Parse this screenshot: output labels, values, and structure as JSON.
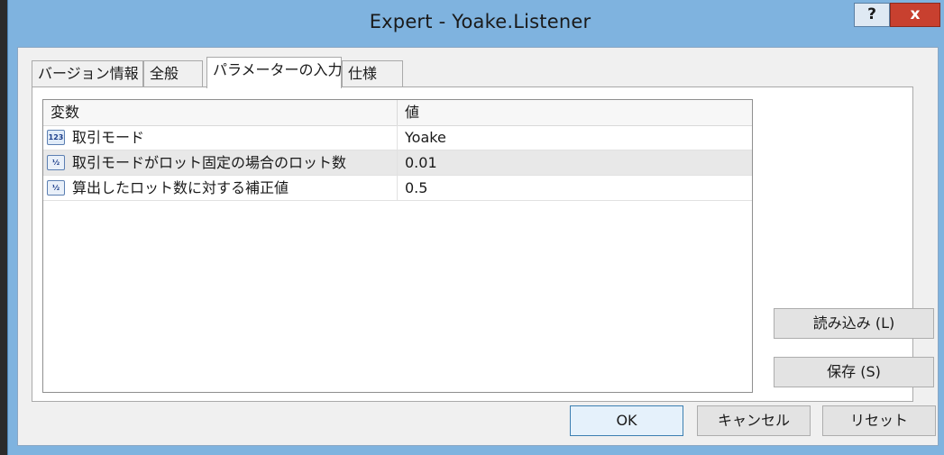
{
  "window": {
    "title": "Expert - Yoake.Listener",
    "help_label": "?",
    "close_label": "x"
  },
  "tabs": [
    {
      "label": "バージョン情報",
      "active": false
    },
    {
      "label": "全般",
      "active": false
    },
    {
      "label": "パラメーターの入力",
      "active": true
    },
    {
      "label": "仕様",
      "active": false
    }
  ],
  "grid": {
    "headers": [
      "変数",
      "値"
    ],
    "rows": [
      {
        "icon": "integer-param-icon",
        "icon_text": "123",
        "name": "取引モード",
        "value": "Yoake",
        "selected": false
      },
      {
        "icon": "double-param-icon",
        "icon_text": "½",
        "name": "取引モードがロット固定の場合のロット数",
        "value": "0.01",
        "selected": true
      },
      {
        "icon": "double-param-icon",
        "icon_text": "½",
        "name": "算出したロット数に対する補正値",
        "value": "0.5",
        "selected": false
      }
    ]
  },
  "side_buttons": {
    "load": "読み込み (L)",
    "save": "保存 (S)"
  },
  "footer_buttons": {
    "ok": "OK",
    "cancel": "キャンセル",
    "reset": "リセット"
  },
  "colors": {
    "frame": "#7fb3df",
    "close": "#c8402f",
    "selected_row": "#e8e8e8"
  }
}
